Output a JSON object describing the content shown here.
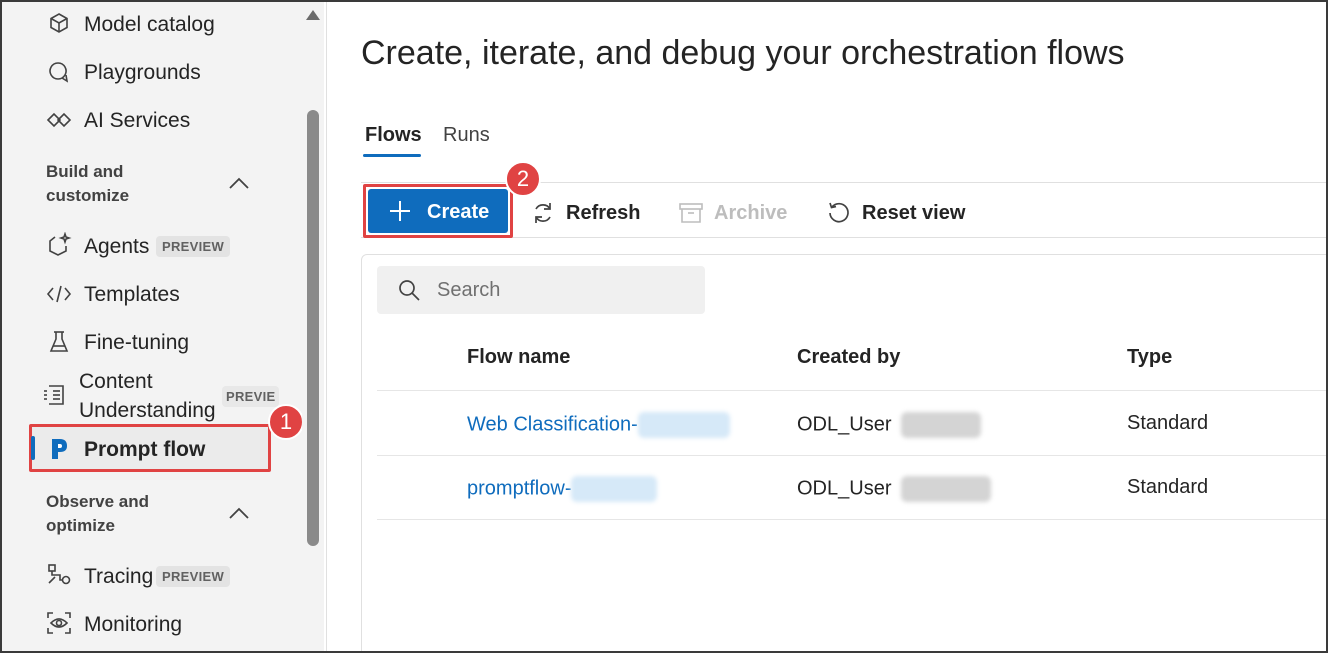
{
  "sidebar": {
    "items": [
      {
        "label": "Model catalog",
        "icon": "cube-icon"
      },
      {
        "label": "Playgrounds",
        "icon": "chat-icon"
      },
      {
        "label": "AI Services",
        "icon": "services-icon"
      }
    ],
    "section_build": "Build and customize",
    "build_items": [
      {
        "label": "Agents",
        "badge": "PREVIEW",
        "icon": "agent-icon"
      },
      {
        "label": "Templates",
        "icon": "code-icon"
      },
      {
        "label": "Fine-tuning",
        "icon": "flask-icon"
      },
      {
        "label_line1": "Content",
        "label_line2": "Understanding",
        "badge": "PREVIE",
        "icon": "document-list-icon"
      },
      {
        "label": "Prompt flow",
        "icon": "prompt-flow-icon"
      }
    ],
    "section_observe": "Observe and optimize",
    "observe_items": [
      {
        "label": "Tracing",
        "badge": "PREVIEW",
        "icon": "tracing-icon"
      },
      {
        "label": "Monitoring",
        "icon": "monitoring-icon"
      }
    ],
    "step_badge": "1"
  },
  "main": {
    "title": "Create, iterate, and debug your orchestration flows",
    "tabs": [
      {
        "label": "Flows",
        "active": true
      },
      {
        "label": "Runs",
        "active": false
      }
    ],
    "toolbar": {
      "create": "Create",
      "refresh": "Refresh",
      "archive": "Archive",
      "reset_view": "Reset view",
      "step_badge": "2"
    },
    "search": {
      "placeholder": "Search"
    },
    "table": {
      "columns": [
        "Flow name",
        "Created by",
        "Type"
      ],
      "rows": [
        {
          "flow_name": "Web Classification-",
          "created_by": "ODL_User",
          "type": "Standard"
        },
        {
          "flow_name": "promptflow-",
          "created_by": "ODL_User",
          "type": "Standard"
        }
      ]
    }
  },
  "colors": {
    "accent": "#0f6cbd",
    "highlight": "#e04343",
    "sidebar_bg": "#f3f3f3"
  }
}
